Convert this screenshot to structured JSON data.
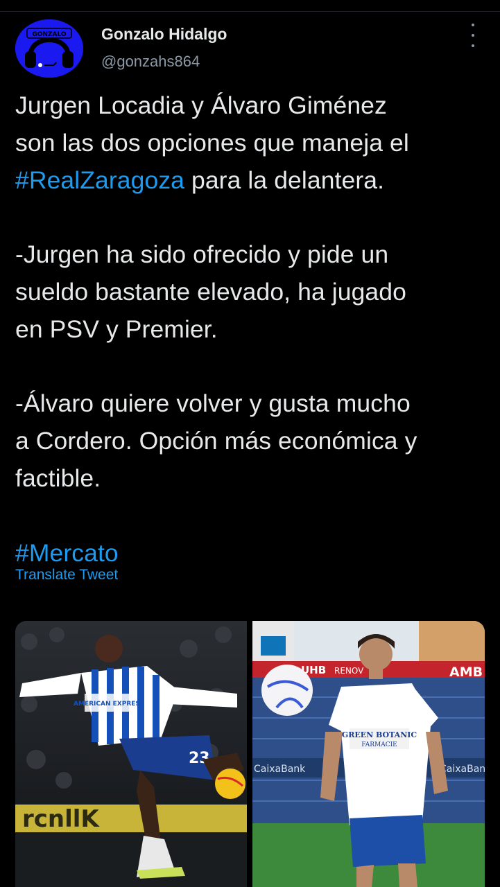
{
  "tweet": {
    "author_name": "Gonzalo Hidalgo",
    "author_handle": "@gonzahs864",
    "avatar_text": "GONZALO",
    "text_lines": [
      "Jurgen Locadia y Álvaro Giménez",
      "son las dos opciones que maneja el",
      "",
      "",
      "-Jurgen ha sido ofrecido y pide un",
      "sueldo bastante elevado, ha jugado",
      "en PSV y Premier.",
      "",
      "-Álvaro quiere volver y gusta mucho",
      "a Cordero. Opción más económica y",
      "factible.",
      ""
    ],
    "hashtag_real_zaragoza": "#RealZaragoza",
    "line3_rest": " para la delantera.",
    "hashtag_mercato": "#Mercato",
    "translate_label": "Translate Tweet"
  },
  "media": {
    "left_photo_text": "AMERICAN EXPRESS",
    "left_photo_number": "23",
    "right_photo_text": "GREEN BOTANIC",
    "right_photo_text2": "FARMACIE",
    "right_sign1": "AMB",
    "right_sign2": "RENOV",
    "right_sign3": "UHB",
    "right_sign4": "CaixaBank",
    "left_board_text": "rcnllK"
  },
  "colors": {
    "background": "#000000",
    "text": "#e7e9ea",
    "secondary": "#8b98a5",
    "link": "#1d9bf0",
    "avatar_bg": "#1a1af0"
  },
  "icons": {
    "more": "more-vertical-icon"
  }
}
